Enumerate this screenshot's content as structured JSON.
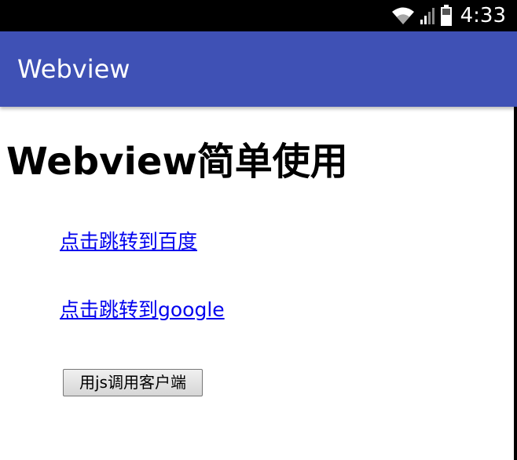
{
  "status_bar": {
    "time": "4:33",
    "icons": [
      "wifi-icon",
      "cellular-signal-icon",
      "battery-icon"
    ]
  },
  "app_bar": {
    "title": "Webview",
    "color": "#3f51b5"
  },
  "web_page": {
    "heading": "Webview简单使用",
    "links": [
      {
        "label": "点击跳转到百度"
      },
      {
        "label": "点击跳转到google"
      }
    ],
    "button_label": "用js调用客户端",
    "link_color": "#0000ee"
  }
}
